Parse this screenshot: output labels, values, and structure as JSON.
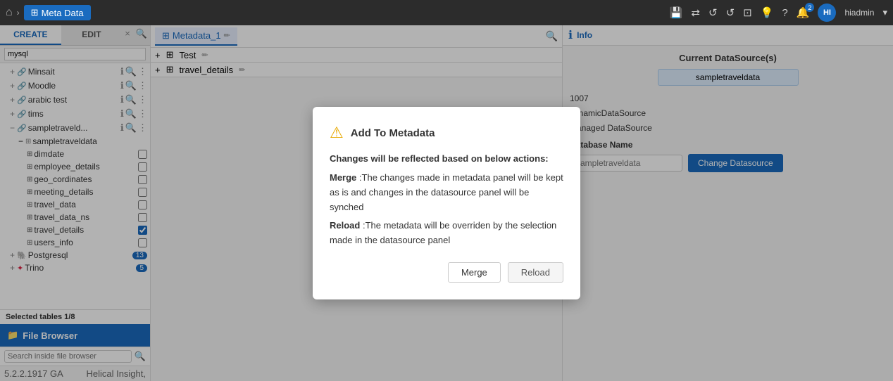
{
  "topNav": {
    "homeIcon": "⌂",
    "chevron": "›",
    "titleLabel": "Meta Data",
    "titleIcon": "⊞",
    "icons": [
      "💾",
      "⇄",
      "↺",
      "↺",
      "⊡",
      "💡",
      "?",
      "🔔"
    ],
    "notificationCount": "2",
    "avatarText": "HI",
    "username": "hiadmin"
  },
  "sidebar": {
    "createTab": "CREATE",
    "editTab": "EDIT",
    "dbFilter": "mysql",
    "treeItems": [
      {
        "id": "minsait",
        "label": "Minsait",
        "indent": 1,
        "prefix": "+",
        "icon": "link"
      },
      {
        "id": "moodle",
        "label": "Moodle",
        "indent": 1,
        "prefix": "+",
        "icon": "link"
      },
      {
        "id": "arabic-test",
        "label": "arabic test",
        "indent": 1,
        "prefix": "+",
        "icon": "link"
      },
      {
        "id": "tims",
        "label": "tims",
        "indent": 1,
        "prefix": "+",
        "icon": "link"
      },
      {
        "id": "sampletraveld",
        "label": "sampletraveld...",
        "indent": 1,
        "prefix": "-",
        "icon": "link"
      },
      {
        "id": "sampletraveldata-db",
        "label": "sampletraveldata",
        "indent": 2,
        "prefix": "",
        "icon": "db"
      },
      {
        "id": "dimdate",
        "label": "dimdate",
        "indent": 3,
        "prefix": "",
        "icon": "table",
        "hasCheckbox": true
      },
      {
        "id": "employee_details",
        "label": "employee_details",
        "indent": 3,
        "prefix": "",
        "icon": "table",
        "hasCheckbox": true
      },
      {
        "id": "geo_cordinates",
        "label": "geo_cordinates",
        "indent": 3,
        "prefix": "",
        "icon": "table",
        "hasCheckbox": true
      },
      {
        "id": "meeting_details",
        "label": "meeting_details",
        "indent": 3,
        "prefix": "",
        "icon": "table",
        "hasCheckbox": true
      },
      {
        "id": "travel_data",
        "label": "travel_data",
        "indent": 3,
        "prefix": "",
        "icon": "table",
        "hasCheckbox": true
      },
      {
        "id": "travel_data_ns",
        "label": "travel_data_ns",
        "indent": 3,
        "prefix": "",
        "icon": "table",
        "hasCheckbox": true
      },
      {
        "id": "travel_details",
        "label": "travel_details",
        "indent": 3,
        "prefix": "",
        "icon": "table",
        "hasCheckbox": true,
        "checked": true
      },
      {
        "id": "users_info",
        "label": "users_info",
        "indent": 3,
        "prefix": "",
        "icon": "table",
        "hasCheckbox": true
      }
    ],
    "postgresql": {
      "label": "Postgresql",
      "count": "13",
      "prefix": "+"
    },
    "trino": {
      "label": "Trino",
      "count": "5",
      "prefix": "+"
    },
    "selectedInfo": "Selected tables 1/8",
    "fileBrowser": "File Browser",
    "searchPlaceholder": "Search inside file browser",
    "version": "5.2.2.1917 GA",
    "helical": "Helical Insight,"
  },
  "centerPanel": {
    "tabLabel": "Metadata_1",
    "editIcon": "✏",
    "searchIcon": "🔍",
    "treeItems": [
      {
        "label": "+ ⊞ Test",
        "editIcon": "✏"
      },
      {
        "label": "+ ⊞ travel_details",
        "editIcon": "✏"
      }
    ]
  },
  "rightPanel": {
    "infoLabel": "Info",
    "heading": "Current DataSource(s)",
    "datasourceValue": "sampletraveldata",
    "fields": [
      {
        "label": "",
        "value": "1007"
      },
      {
        "label": "",
        "value": "dynamicDataSource"
      },
      {
        "label": "",
        "value": "Managed DataSource"
      },
      {
        "label": "Database Name",
        "value": ""
      }
    ],
    "dbNamePlaceholder": "sampletraveldata",
    "changeDatasourceBtn": "Change Datasource"
  },
  "modal": {
    "warningIcon": "⚠",
    "title": "Add To Metadata",
    "bodyBold1": "Changes will be reflected based on below actions:",
    "mergeLabel": "Merge",
    "mergeDesc": " :The changes made in metadata panel will be kept as is and changes in the datasource panel will be synched",
    "reloadLabel": "Reload",
    "reloadDesc": ":The metadata will be overriden by the selection made in the datasource panel",
    "mergeBtn": "Merge",
    "reloadBtn": "Reload"
  }
}
